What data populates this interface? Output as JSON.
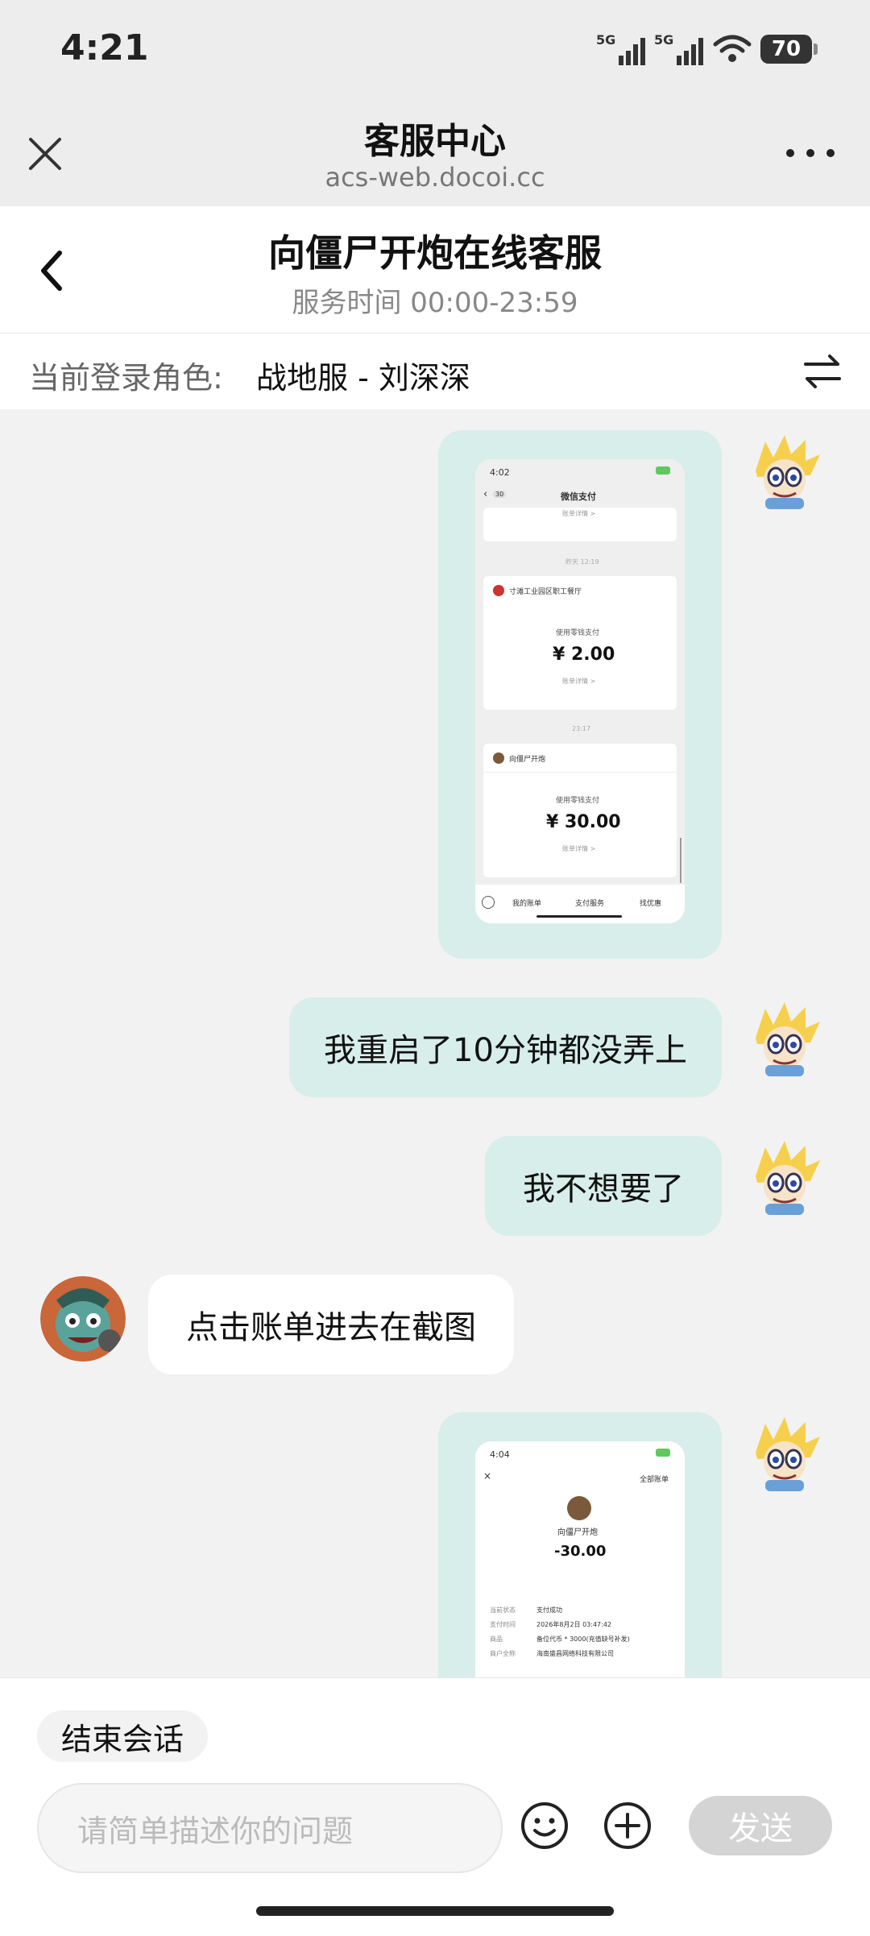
{
  "status_bar": {
    "time": "4:21",
    "network1": "5G",
    "network2": "5G",
    "battery": "70"
  },
  "browser": {
    "title": "客服中心",
    "url": "acs-web.docoi.cc"
  },
  "chat_header": {
    "title": "向僵尸开炮在线客服",
    "hours": "服务时间 00:00-23:59"
  },
  "role_bar": {
    "label": "当前登录角色:",
    "value": "战地服 - 刘深深"
  },
  "messages": [
    {
      "type": "image",
      "from": "user",
      "screenshot": {
        "time": "4:02",
        "title": "微信支付",
        "badge": "30",
        "link_top": "账单详情 >",
        "date1": "昨天 12:19",
        "merchant1": "寸滩工业园区职工餐厅",
        "method1": "使用零钱支付",
        "amount1": "¥ 2.00",
        "link1": "账单详情 >",
        "date2": "23:17",
        "merchant2": "向僵尸开炮",
        "method2": "使用零钱支付",
        "amount2": "¥ 30.00",
        "link2": "账单详情 >",
        "tabs": [
          "我的账单",
          "支付服务",
          "找优惠"
        ]
      }
    },
    {
      "type": "text",
      "from": "user",
      "text": "我重启了10分钟都没弄上"
    },
    {
      "type": "text",
      "from": "user",
      "text": "我不想要了"
    },
    {
      "type": "text",
      "from": "agent",
      "text": "点击账单进去在截图"
    },
    {
      "type": "image",
      "from": "user",
      "screenshot": {
        "time": "4:04",
        "all_bills": "全部账单",
        "merchant": "向僵尸开炮",
        "amount": "-30.00",
        "rows": [
          {
            "k": "当前状态",
            "v": "支付成功"
          },
          {
            "k": "支付时间",
            "v": "2026年8月2日 03:47:42"
          },
          {
            "k": "商品",
            "v": "备位代币 * 3000(充值缺号补发)"
          },
          {
            "k": "商户全称",
            "v": "海南盛昌网络科技有限公司"
          }
        ]
      }
    }
  ],
  "bottom": {
    "end_session": "结束会话",
    "input_placeholder": "请简单描述你的问题",
    "send": "发送"
  }
}
